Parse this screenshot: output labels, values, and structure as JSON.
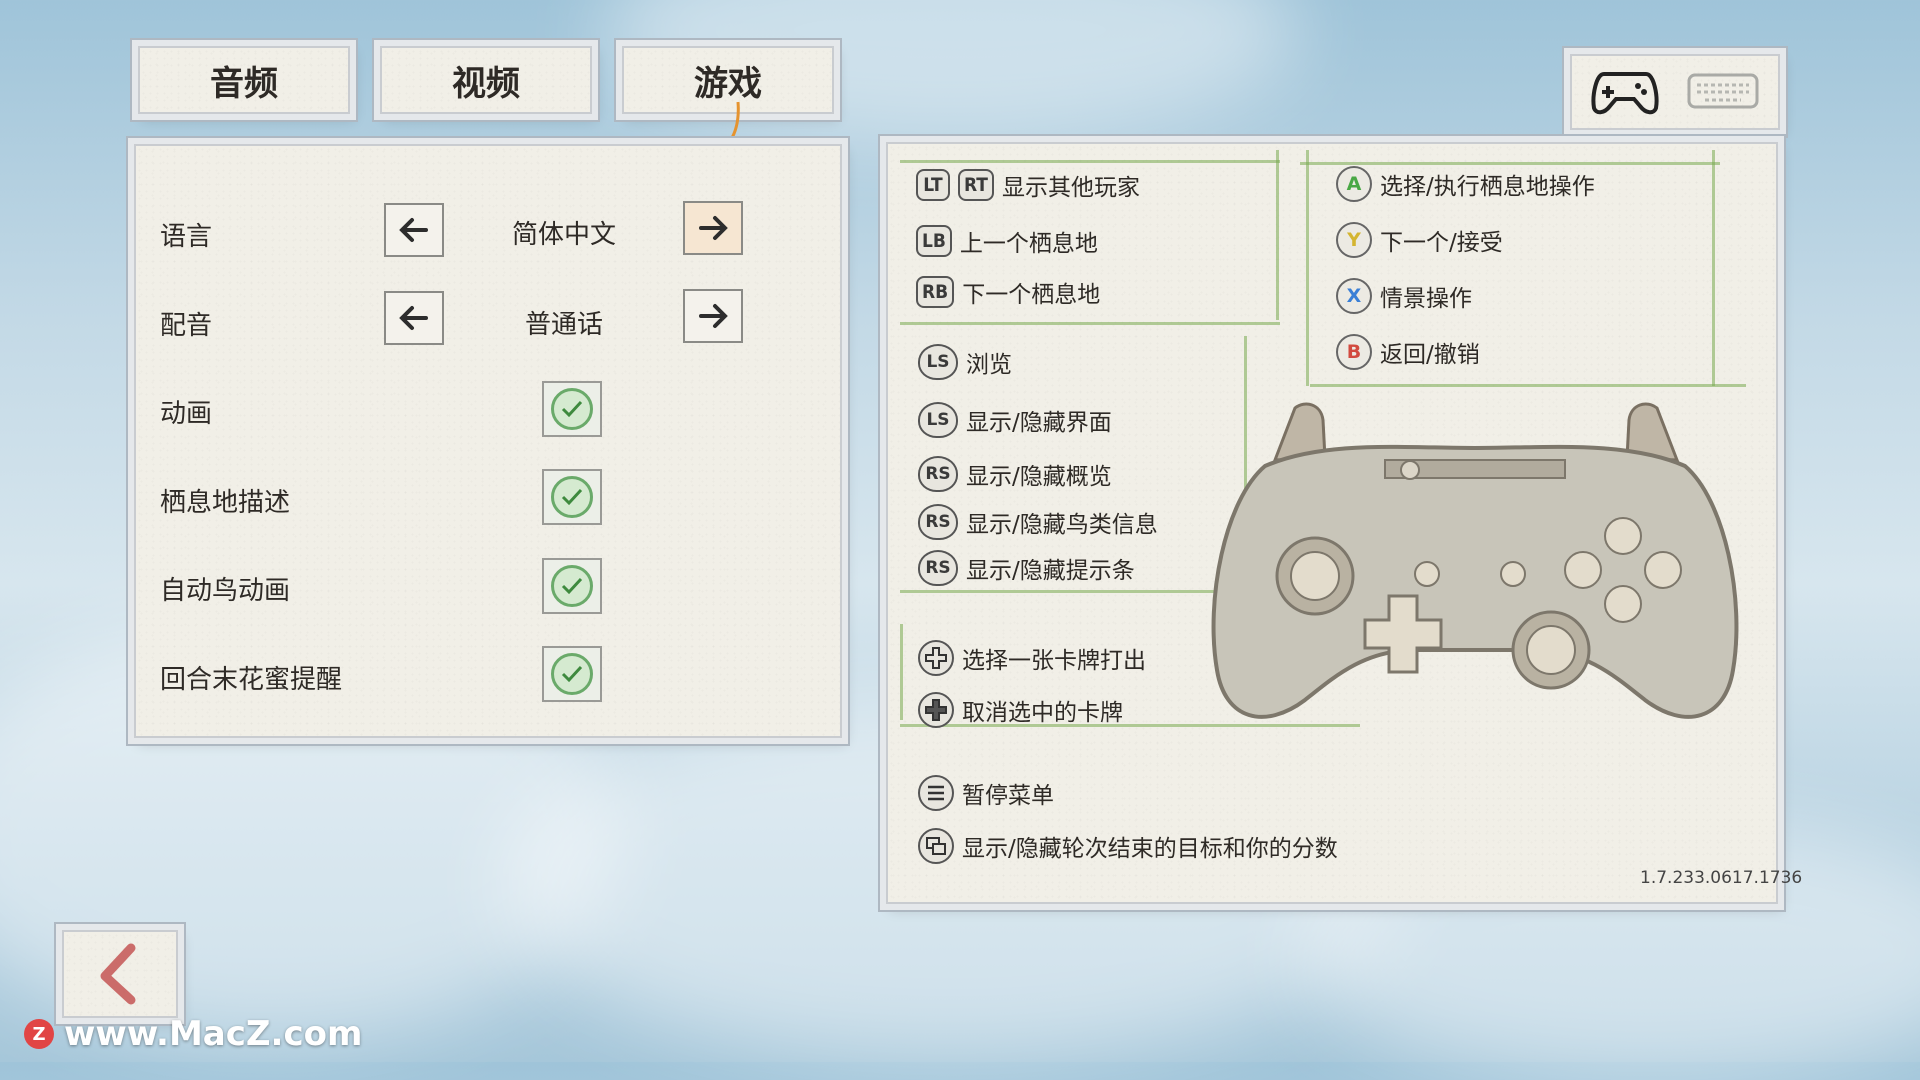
{
  "tabs": [
    {
      "label": "音频"
    },
    {
      "label": "视频"
    },
    {
      "label": "游戏"
    }
  ],
  "settings": {
    "language": {
      "label": "语言",
      "value": "简体中文"
    },
    "voice": {
      "label": "配音",
      "value": "普通话"
    },
    "animation": {
      "label": "动画",
      "checked": true
    },
    "habitat_desc": {
      "label": "栖息地描述",
      "checked": true
    },
    "auto_bird_anim": {
      "label": "自动鸟动画",
      "checked": true
    },
    "nectar_reminder": {
      "label": "回合末花蜜提醒",
      "checked": true
    }
  },
  "input_switch": {
    "controller": "gamepad-icon",
    "keyboard": "keyboard-icon"
  },
  "controls": {
    "lt": "LT",
    "rt": "RT",
    "show_players": "显示其他玩家",
    "lb": "LB",
    "prev_habitat": "上一个栖息地",
    "rb": "RB",
    "next_habitat": "下一个栖息地",
    "a": "A",
    "a_label": "选择/执行栖息地操作",
    "y": "Y",
    "y_label": "下一个/接受",
    "x": "X",
    "x_label": "情景操作",
    "b": "B",
    "b_label": "返回/撤销",
    "ls": "LS",
    "browse": "浏览",
    "toggle_ui": "显示/隐藏界面",
    "rs": "RS",
    "toggle_overview": "显示/隐藏概览",
    "toggle_bird_info": "显示/隐藏鸟类信息",
    "toggle_tips": "显示/隐藏提示条",
    "play_card": "选择一张卡牌打出",
    "deselect_card": "取消选中的卡牌",
    "pause_menu": "暂停菜单",
    "toggle_goals": "显示/隐藏轮次结束的目标和你的分数"
  },
  "version": "1.7.233.0617.1736",
  "watermark": "www.MacZ.com",
  "colors": {
    "a_green": "#49a845",
    "y_yellow": "#d4b531",
    "x_blue": "#3a7fd6",
    "b_red": "#d24a3f",
    "check_green": "#6aaa6a"
  }
}
